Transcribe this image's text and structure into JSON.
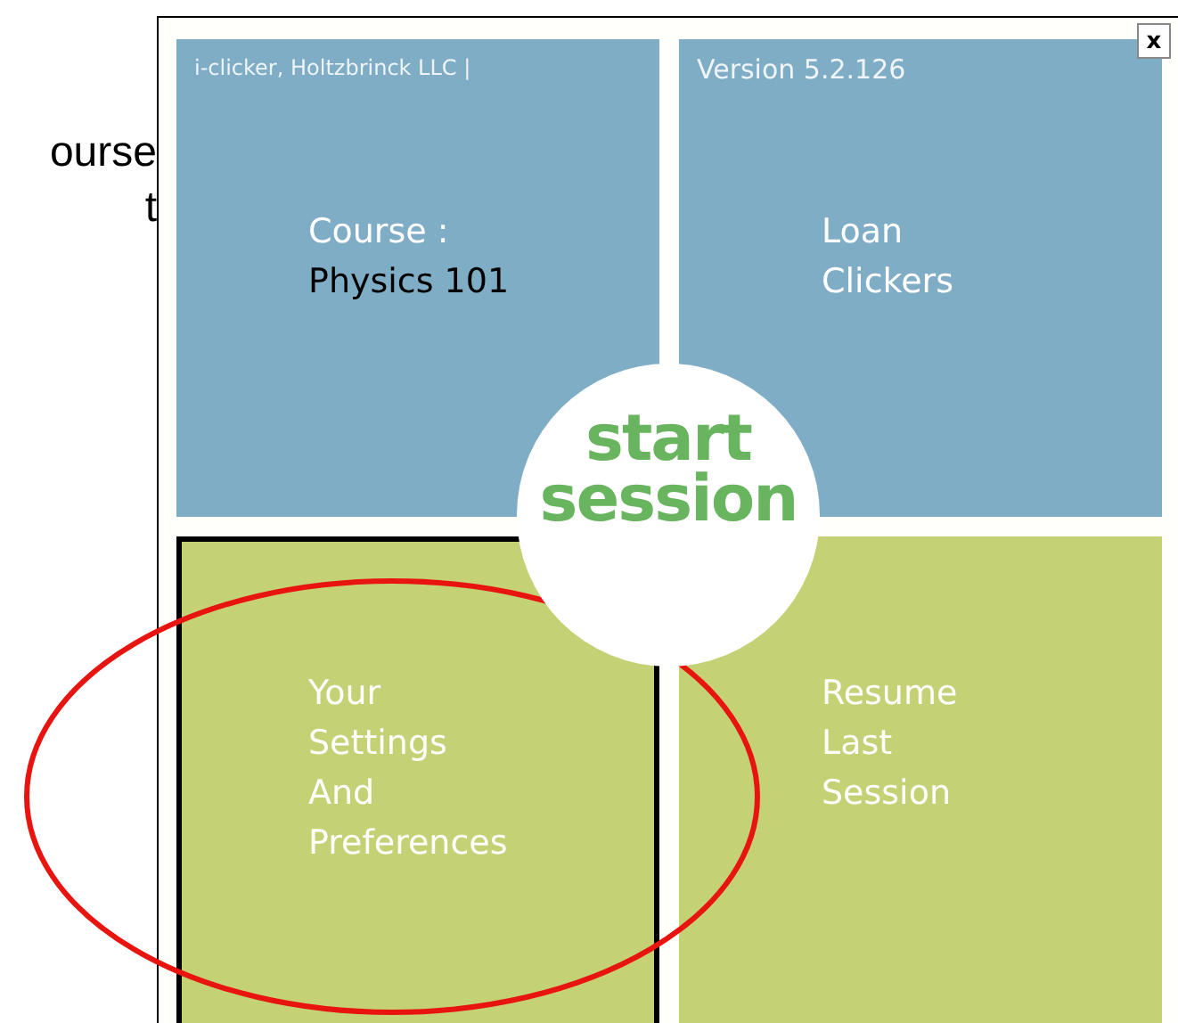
{
  "backdrop_text": [
    "ourse",
    "t"
  ],
  "window": {
    "close_button": "x",
    "tiles": [
      {
        "kind": "course",
        "caption": "i-clicker, Holtzbrinck LLC |",
        "lines": [
          "Course :"
        ],
        "value": "Physics 101",
        "color": "#7fadc6",
        "selected": false
      },
      {
        "kind": "action",
        "caption": "Version 5.2.126",
        "lines": [
          "Loan",
          "Clickers"
        ],
        "color": "#7fadc6",
        "selected": false
      },
      {
        "kind": "action",
        "lines": [
          "Your",
          "Settings",
          "And",
          "Preferences"
        ],
        "color": "#c4d174",
        "selected": true
      },
      {
        "kind": "action",
        "lines": [
          "Resume",
          "Last",
          "Session"
        ],
        "color": "#c4d174",
        "selected": false
      }
    ],
    "start_button": [
      "start",
      "session"
    ]
  }
}
